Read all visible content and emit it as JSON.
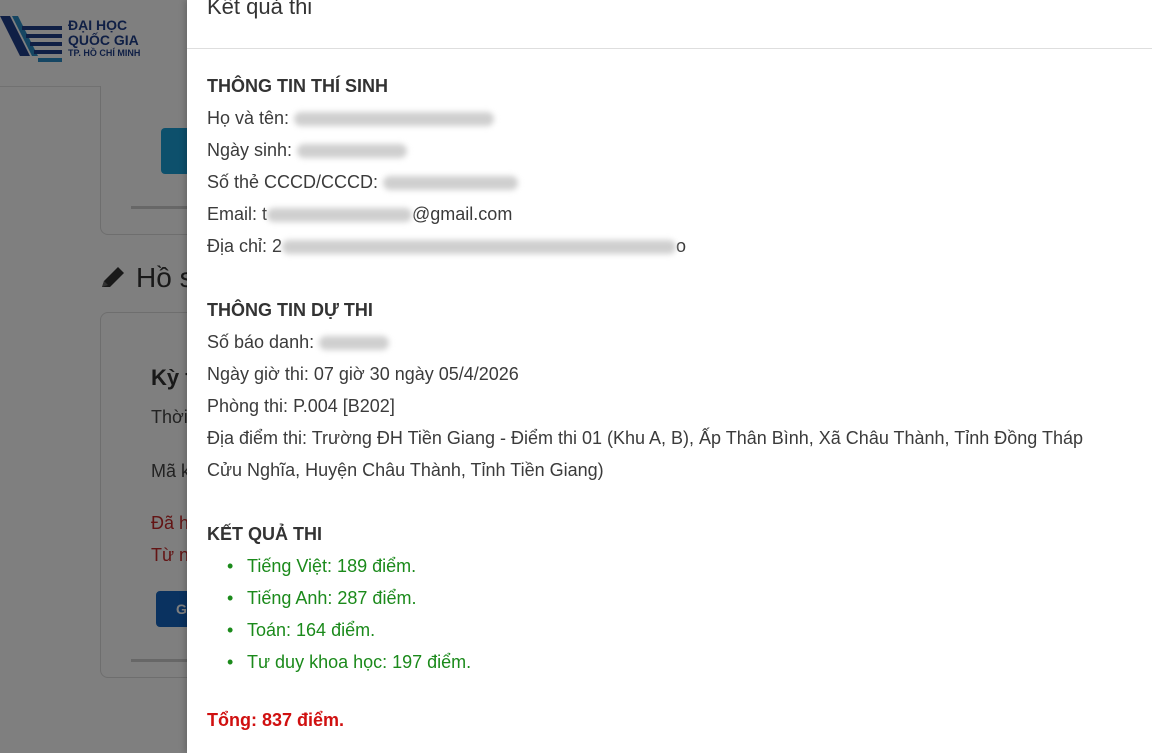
{
  "header": {
    "logo_line1": "ĐẠI HỌC",
    "logo_line2": "QUỐC GIA",
    "logo_line3": "TP. HỒ CHÍ MINH"
  },
  "background": {
    "section_title": "Hồ s",
    "card_title": "Kỳ t",
    "card_line1": "Thời",
    "card_line2": "Mã k",
    "card_line3": "Đã h",
    "card_line4": "Từ n",
    "card_button": "Gi"
  },
  "modal": {
    "title": "Kết quả thi",
    "candidate": {
      "heading": "THÔNG TIN THÍ SINH",
      "name_label": "Họ và tên: ",
      "dob_label": "Ngày sinh: ",
      "id_label": "Số thẻ CCCD/CCCD: ",
      "email_label": "Email: t",
      "email_suffix": "@gmail.com",
      "address_label": "Địa chỉ: 2",
      "address_suffix": "o"
    },
    "exam": {
      "heading": "THÔNG TIN DỰ THI",
      "sbd_label": "Số báo danh: ",
      "datetime": "Ngày giờ thi: 07 giờ 30 ngày 05/4/2026",
      "room": "Phòng thi: P.004 [B202]",
      "location_line1": "Địa điểm thi: Trường ĐH Tiền Giang - Điểm thi 01 (Khu A, B), Ấp Thân Bình, Xã Châu Thành, Tỉnh Đồng Tháp",
      "location_line2": "Cửu Nghĩa, Huyện Châu Thành, Tỉnh Tiền Giang)"
    },
    "results": {
      "heading": "KẾT QUẢ THI",
      "items": [
        "Tiếng Việt: 189 điểm.",
        "Tiếng Anh: 287 điểm.",
        "Toán: 164 điểm.",
        "Tư duy khoa học: 197 điểm."
      ],
      "total": "Tổng: 837 điểm."
    }
  },
  "colors": {
    "result_green": "#1b8a1b",
    "total_red": "#d01010",
    "logo_blue": "#1f3f8a"
  }
}
